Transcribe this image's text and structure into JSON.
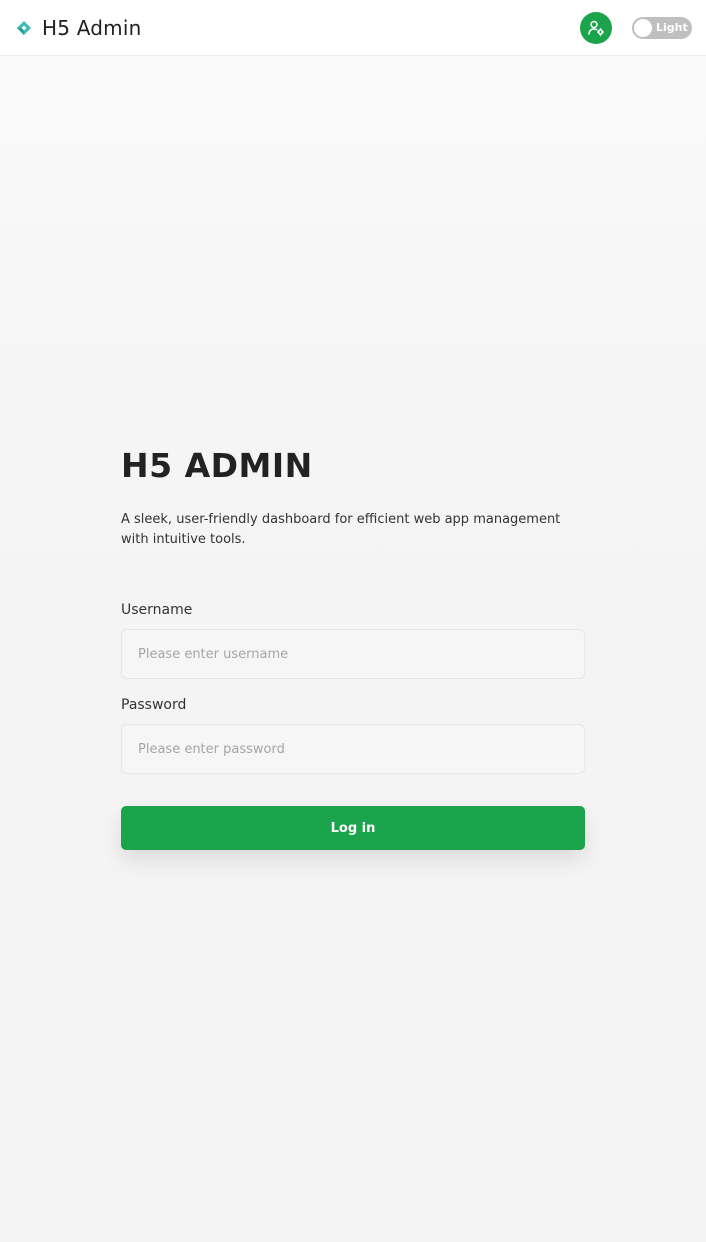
{
  "header": {
    "brand_title": "H5 Admin",
    "logo_icon": "diamond-logo-icon",
    "user_icon": "user-settings-icon",
    "theme_toggle_label": "Light"
  },
  "login": {
    "title": "H5 ADMIN",
    "description": "A sleek, user-friendly dashboard for efficient web app management with intuitive tools.",
    "username_label": "Username",
    "username_placeholder": "Please enter username",
    "username_value": "",
    "password_label": "Password",
    "password_placeholder": "Please enter password",
    "password_value": "",
    "submit_label": "Log in"
  },
  "colors": {
    "primary": "#1ca44d",
    "logo_teal": "#3bbcb4",
    "toggle_off": "#bfbfbf",
    "page_background": "#f3f3f3"
  }
}
